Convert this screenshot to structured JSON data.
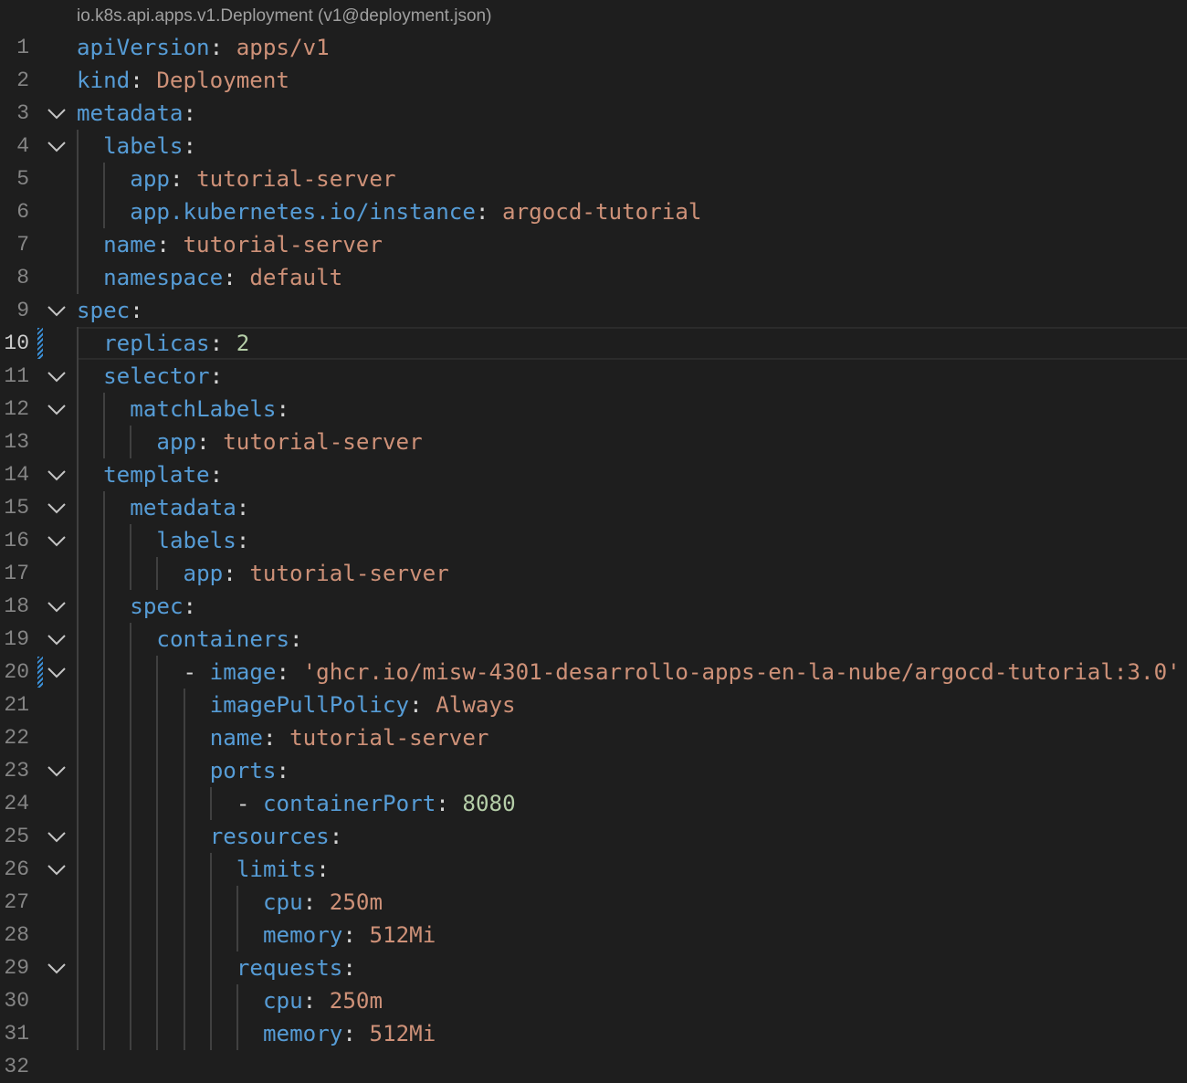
{
  "header": {
    "schema_label": "io.k8s.api.apps.v1.Deployment (v1@deployment.json)"
  },
  "lines": [
    {
      "no": "1",
      "indent": 0,
      "fold": false,
      "tokens": [
        {
          "t": "k",
          "v": "apiVersion"
        },
        {
          "t": "p",
          "v": ": "
        },
        {
          "t": "s",
          "v": "apps/v1"
        }
      ]
    },
    {
      "no": "2",
      "indent": 0,
      "fold": false,
      "tokens": [
        {
          "t": "k",
          "v": "kind"
        },
        {
          "t": "p",
          "v": ": "
        },
        {
          "t": "s",
          "v": "Deployment"
        }
      ]
    },
    {
      "no": "3",
      "indent": 0,
      "fold": true,
      "tokens": [
        {
          "t": "k",
          "v": "metadata"
        },
        {
          "t": "p",
          "v": ":"
        }
      ]
    },
    {
      "no": "4",
      "indent": 2,
      "fold": true,
      "tokens": [
        {
          "t": "k",
          "v": "labels"
        },
        {
          "t": "p",
          "v": ":"
        }
      ]
    },
    {
      "no": "5",
      "indent": 4,
      "fold": false,
      "tokens": [
        {
          "t": "k",
          "v": "app"
        },
        {
          "t": "p",
          "v": ": "
        },
        {
          "t": "s",
          "v": "tutorial-server"
        }
      ]
    },
    {
      "no": "6",
      "indent": 4,
      "fold": false,
      "tokens": [
        {
          "t": "k",
          "v": "app.kubernetes.io/instance"
        },
        {
          "t": "p",
          "v": ": "
        },
        {
          "t": "s",
          "v": "argocd-tutorial"
        }
      ]
    },
    {
      "no": "7",
      "indent": 2,
      "fold": false,
      "tokens": [
        {
          "t": "k",
          "v": "name"
        },
        {
          "t": "p",
          "v": ": "
        },
        {
          "t": "s",
          "v": "tutorial-server"
        }
      ]
    },
    {
      "no": "8",
      "indent": 2,
      "fold": false,
      "tokens": [
        {
          "t": "k",
          "v": "namespace"
        },
        {
          "t": "p",
          "v": ": "
        },
        {
          "t": "s",
          "v": "default"
        }
      ]
    },
    {
      "no": "9",
      "indent": 0,
      "fold": true,
      "tokens": [
        {
          "t": "k",
          "v": "spec"
        },
        {
          "t": "p",
          "v": ":"
        }
      ]
    },
    {
      "no": "10",
      "indent": 2,
      "fold": false,
      "current": true,
      "modified": true,
      "tokens": [
        {
          "t": "k",
          "v": "replicas"
        },
        {
          "t": "p",
          "v": ": "
        },
        {
          "t": "n",
          "v": "2"
        }
      ]
    },
    {
      "no": "11",
      "indent": 2,
      "fold": true,
      "tokens": [
        {
          "t": "k",
          "v": "selector"
        },
        {
          "t": "p",
          "v": ":"
        }
      ]
    },
    {
      "no": "12",
      "indent": 4,
      "fold": true,
      "tokens": [
        {
          "t": "k",
          "v": "matchLabels"
        },
        {
          "t": "p",
          "v": ":"
        }
      ]
    },
    {
      "no": "13",
      "indent": 6,
      "fold": false,
      "tokens": [
        {
          "t": "k",
          "v": "app"
        },
        {
          "t": "p",
          "v": ": "
        },
        {
          "t": "s",
          "v": "tutorial-server"
        }
      ]
    },
    {
      "no": "14",
      "indent": 2,
      "fold": true,
      "tokens": [
        {
          "t": "k",
          "v": "template"
        },
        {
          "t": "p",
          "v": ":"
        }
      ]
    },
    {
      "no": "15",
      "indent": 4,
      "fold": true,
      "tokens": [
        {
          "t": "k",
          "v": "metadata"
        },
        {
          "t": "p",
          "v": ":"
        }
      ]
    },
    {
      "no": "16",
      "indent": 6,
      "fold": true,
      "tokens": [
        {
          "t": "k",
          "v": "labels"
        },
        {
          "t": "p",
          "v": ":"
        }
      ]
    },
    {
      "no": "17",
      "indent": 8,
      "fold": false,
      "tokens": [
        {
          "t": "k",
          "v": "app"
        },
        {
          "t": "p",
          "v": ": "
        },
        {
          "t": "s",
          "v": "tutorial-server"
        }
      ]
    },
    {
      "no": "18",
      "indent": 4,
      "fold": true,
      "tokens": [
        {
          "t": "k",
          "v": "spec"
        },
        {
          "t": "p",
          "v": ":"
        }
      ]
    },
    {
      "no": "19",
      "indent": 6,
      "fold": true,
      "tokens": [
        {
          "t": "k",
          "v": "containers"
        },
        {
          "t": "p",
          "v": ":"
        }
      ]
    },
    {
      "no": "20",
      "indent": 8,
      "fold": true,
      "modified": true,
      "tokens": [
        {
          "t": "d",
          "v": "- "
        },
        {
          "t": "k",
          "v": "image"
        },
        {
          "t": "p",
          "v": ": "
        },
        {
          "t": "s",
          "v": "'ghcr.io/misw-4301-desarrollo-apps-en-la-nube/argocd-tutorial:3.0'"
        }
      ]
    },
    {
      "no": "21",
      "indent": 10,
      "fold": false,
      "tokens": [
        {
          "t": "k",
          "v": "imagePullPolicy"
        },
        {
          "t": "p",
          "v": ": "
        },
        {
          "t": "s",
          "v": "Always"
        }
      ]
    },
    {
      "no": "22",
      "indent": 10,
      "fold": false,
      "tokens": [
        {
          "t": "k",
          "v": "name"
        },
        {
          "t": "p",
          "v": ": "
        },
        {
          "t": "s",
          "v": "tutorial-server"
        }
      ]
    },
    {
      "no": "23",
      "indent": 10,
      "fold": true,
      "tokens": [
        {
          "t": "k",
          "v": "ports"
        },
        {
          "t": "p",
          "v": ":"
        }
      ]
    },
    {
      "no": "24",
      "indent": 12,
      "fold": false,
      "tokens": [
        {
          "t": "d",
          "v": "- "
        },
        {
          "t": "k",
          "v": "containerPort"
        },
        {
          "t": "p",
          "v": ": "
        },
        {
          "t": "n",
          "v": "8080"
        }
      ]
    },
    {
      "no": "25",
      "indent": 10,
      "fold": true,
      "tokens": [
        {
          "t": "k",
          "v": "resources"
        },
        {
          "t": "p",
          "v": ":"
        }
      ]
    },
    {
      "no": "26",
      "indent": 12,
      "fold": true,
      "tokens": [
        {
          "t": "k",
          "v": "limits"
        },
        {
          "t": "p",
          "v": ":"
        }
      ]
    },
    {
      "no": "27",
      "indent": 14,
      "fold": false,
      "tokens": [
        {
          "t": "k",
          "v": "cpu"
        },
        {
          "t": "p",
          "v": ": "
        },
        {
          "t": "s",
          "v": "250m"
        }
      ]
    },
    {
      "no": "28",
      "indent": 14,
      "fold": false,
      "tokens": [
        {
          "t": "k",
          "v": "memory"
        },
        {
          "t": "p",
          "v": ": "
        },
        {
          "t": "s",
          "v": "512Mi"
        }
      ]
    },
    {
      "no": "29",
      "indent": 12,
      "fold": true,
      "tokens": [
        {
          "t": "k",
          "v": "requests"
        },
        {
          "t": "p",
          "v": ":"
        }
      ]
    },
    {
      "no": "30",
      "indent": 14,
      "fold": false,
      "tokens": [
        {
          "t": "k",
          "v": "cpu"
        },
        {
          "t": "p",
          "v": ": "
        },
        {
          "t": "s",
          "v": "250m"
        }
      ]
    },
    {
      "no": "31",
      "indent": 14,
      "fold": false,
      "tokens": [
        {
          "t": "k",
          "v": "memory"
        },
        {
          "t": "p",
          "v": ": "
        },
        {
          "t": "s",
          "v": "512Mi"
        }
      ]
    },
    {
      "no": "32",
      "indent": 0,
      "fold": false,
      "tokens": []
    }
  ],
  "colors": {
    "background": "#1e1e1e",
    "key": "#569cd6",
    "string": "#ce9178",
    "number": "#b5cea8",
    "line_number": "#858585",
    "active_line_number": "#cccccc",
    "indent_guide": "#404040",
    "modified_marker": "#3b8fd6"
  },
  "icons": {
    "fold": "chevron-down-icon",
    "modified": "modified-line-marker"
  }
}
